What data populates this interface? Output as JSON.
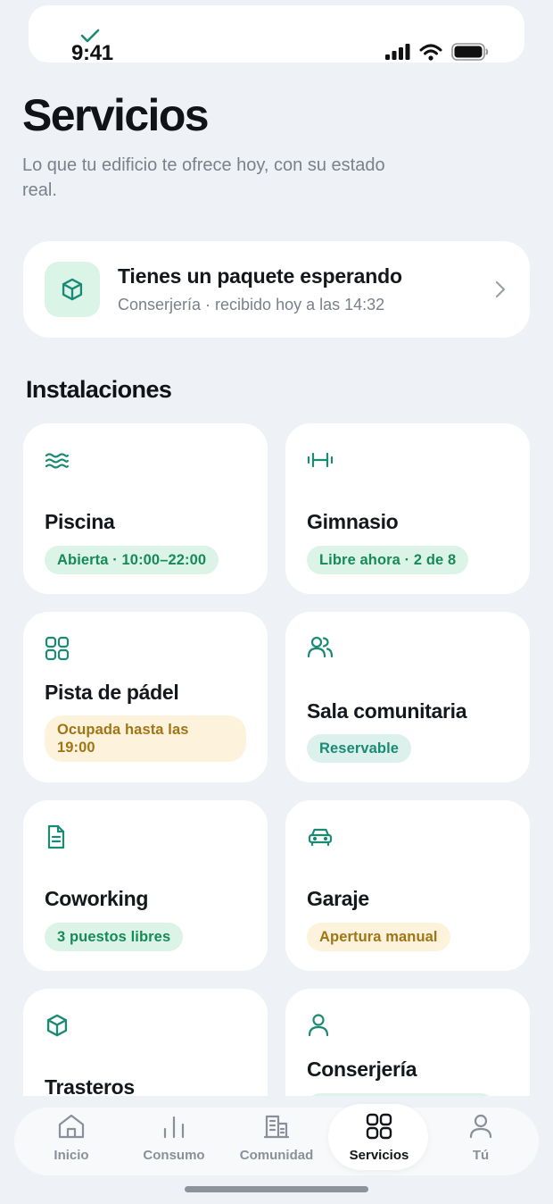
{
  "status_bar": {
    "time": "9:41"
  },
  "header": {
    "title": "Servicios",
    "subtitle": "Lo que tu edificio te ofrece hoy, con su estado real."
  },
  "package_card": {
    "title": "Tienes un paquete esperando",
    "subtitle": "Conserjería · recibido hoy a las 14:32",
    "icon": "package-icon"
  },
  "facilities": {
    "section_title": "Instalaciones",
    "items": [
      {
        "name": "Piscina",
        "status": "Abierta · 10:00–22:00",
        "tone": "green",
        "icon": "waves-icon"
      },
      {
        "name": "Gimnasio",
        "status": "Libre ahora · 2 de 8",
        "tone": "green",
        "icon": "dumbbell-icon"
      },
      {
        "name": "Pista de pádel",
        "status_line1": "Ocupada hasta las",
        "status_line2": "19:00",
        "tone": "amber",
        "icon": "grid-icon"
      },
      {
        "name": "Sala comunitaria",
        "status": "Reservable",
        "tone": "teal",
        "icon": "users-icon"
      },
      {
        "name": "Coworking",
        "status": "3 puestos libres",
        "tone": "green",
        "icon": "document-icon"
      },
      {
        "name": "Garaje",
        "status": "Apertura manual",
        "tone": "amber",
        "icon": "car-icon"
      },
      {
        "name": "Trasteros",
        "icon": "box-icon"
      },
      {
        "name": "Conserjería",
        "icon": "person-icon"
      }
    ]
  },
  "tabbar": {
    "items": [
      {
        "label": "Inicio",
        "icon": "home-icon"
      },
      {
        "label": "Consumo",
        "icon": "bar-chart-icon"
      },
      {
        "label": "Comunidad",
        "icon": "building-icon"
      },
      {
        "label": "Servicios",
        "icon": "grid-icon",
        "active": true
      },
      {
        "label": "Tú",
        "icon": "user-icon"
      }
    ]
  },
  "colors": {
    "background": "#eef1f5",
    "accent": "#1b8a75",
    "green_badge_bg": "#dcf4e8",
    "green_badge_text": "#168a57",
    "amber_badge_bg": "#fdf3dc",
    "amber_badge_text": "#a17414"
  }
}
